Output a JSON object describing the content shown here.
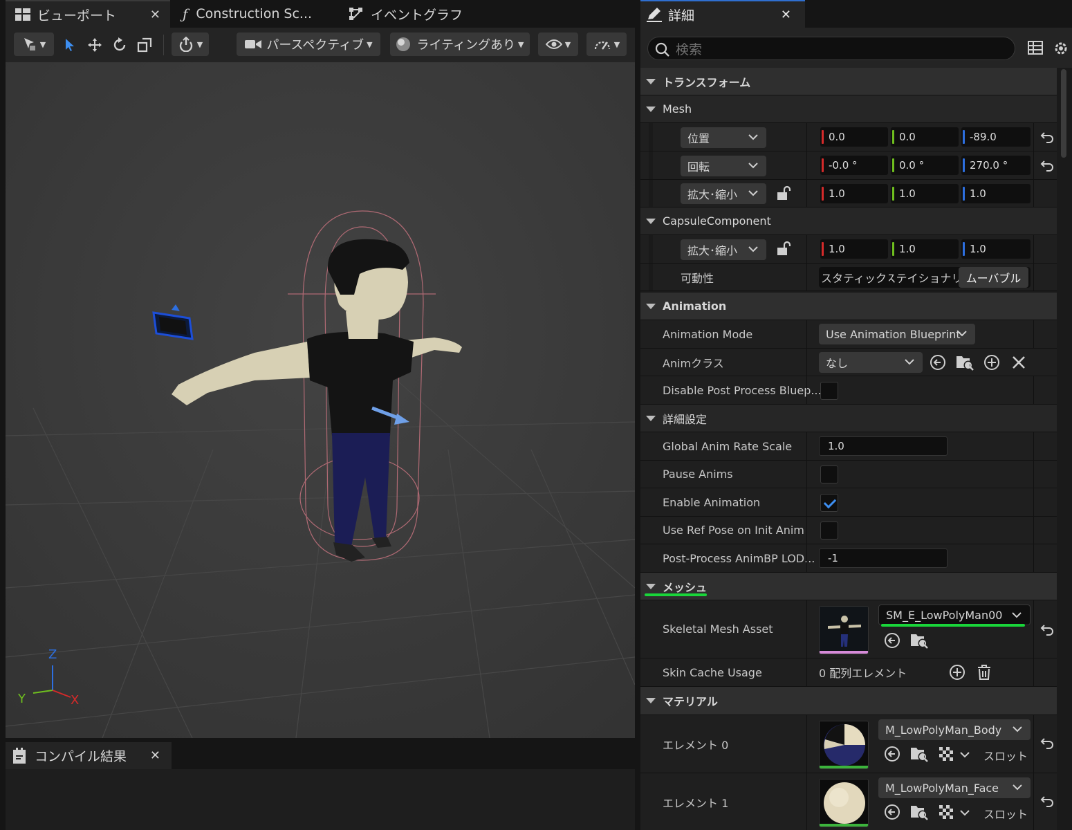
{
  "tabs": {
    "viewport": "ビューポート",
    "construction": "Construction Sc...",
    "eventgraph": "イベントグラフ"
  },
  "viewport_toolbar": {
    "view_mode": "パースペクティブ",
    "lighting": "ライティングあり"
  },
  "axes": {
    "z": "Z",
    "y": "Y",
    "x": "X"
  },
  "compile": {
    "tab": "コンパイル結果"
  },
  "details": {
    "tab": "詳細",
    "search_placeholder": "検索",
    "transform": {
      "header": "トランスフォーム",
      "mesh_header": "Mesh",
      "location_label": "位置",
      "location": [
        "0.0",
        "0.0",
        "-89.0"
      ],
      "rotation_label": "回転",
      "rotation": [
        "-0.0 °",
        "0.0 °",
        "270.0 °"
      ],
      "scale_label": "拡大･縮小",
      "scale": [
        "1.0",
        "1.0",
        "1.0"
      ],
      "capsule_header": "CapsuleComponent",
      "capsule_scale_label": "拡大･縮小",
      "capsule_scale": [
        "1.0",
        "1.0",
        "1.0"
      ],
      "mobility_label": "可動性",
      "mobility_options": [
        "スタティック",
        "ステイショナリ",
        "ムーバブル"
      ]
    },
    "animation": {
      "header": "Animation",
      "mode_label": "Animation Mode",
      "mode_value": "Use Animation Blueprint",
      "class_label": "Animクラス",
      "class_value": "なし",
      "disable_pp_label": "Disable Post Process Bluep...",
      "disable_pp_checked": false
    },
    "advanced": {
      "header": "詳細設定",
      "rate_label": "Global Anim Rate Scale",
      "rate_value": "1.0",
      "pause_label": "Pause Anims",
      "pause_checked": false,
      "enable_label": "Enable Animation",
      "enable_checked": true,
      "refpose_label": "Use Ref Pose on Init Anim",
      "refpose_checked": false,
      "lod_label": "Post-Process AnimBP LOD...",
      "lod_value": "-1"
    },
    "mesh": {
      "header": "メッシュ",
      "skeletal_label": "Skeletal Mesh Asset",
      "skeletal_value": "SM_E_LowPolyMan00",
      "skin_label": "Skin Cache Usage",
      "skin_value": "0 配列エレメント"
    },
    "materials": {
      "header": "マテリアル",
      "elements": [
        {
          "label": "エレメント 0",
          "value": "M_LowPolyMan_Body",
          "slot": "スロット"
        },
        {
          "label": "エレメント 1",
          "value": "M_LowPolyMan_Face",
          "slot": "スロット"
        }
      ]
    }
  },
  "colors": {
    "axis_x": "#d42a2a",
    "axis_y": "#6fbf1f",
    "axis_z": "#2d6fe0",
    "accent": "#2f6fd0",
    "highlight": "#19d63a"
  }
}
